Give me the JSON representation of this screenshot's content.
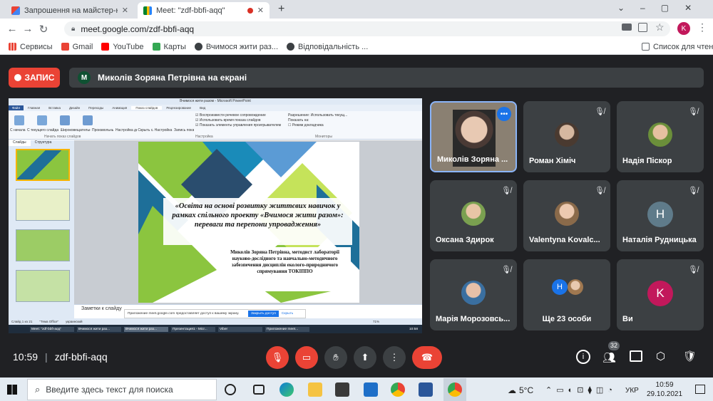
{
  "browser": {
    "tabs": [
      {
        "title": "Запрошення на майстер-клас «Осв",
        "favicon": "gmail-icon",
        "active": false
      },
      {
        "title": "Meet: \"zdf-bbfi-aqq\"",
        "favicon": "meet-icon",
        "active": true
      }
    ],
    "new_tab": "+",
    "url": "meet.google.com/zdf-bbfi-aqq",
    "profile_letter": "K",
    "bookmarks": [
      "Сервисы",
      "Gmail",
      "YouTube",
      "Карты",
      "Вчимося жити раз...",
      "Відповідальність ...",
      "Список для чтения"
    ]
  },
  "meet": {
    "record_label": "ЗАПИС",
    "presenter_avatar": "M",
    "presenter_banner": "Миколів Зоряна Петрівна на екрані",
    "tiles": [
      {
        "name": "Миколів Зоряна ...",
        "type": "video"
      },
      {
        "name": "Роман Хіміч",
        "type": "photo"
      },
      {
        "name": "Надія Піскор",
        "type": "photo"
      },
      {
        "name": "Оксана Здирок",
        "type": "photo"
      },
      {
        "name": "Valentyna Kovalc...",
        "type": "photo"
      },
      {
        "name": "Наталія Рудницька",
        "type": "letter",
        "letter": "Н",
        "color": "#5f7b8a"
      },
      {
        "name": "Марія Морозовсь...",
        "type": "photo"
      },
      {
        "name": "Ще 23 особи",
        "type": "group",
        "letter": "Н"
      },
      {
        "name": "Ви",
        "type": "letter",
        "letter": "K",
        "color": "#c2185b"
      }
    ],
    "time": "10:59",
    "meeting_code": "zdf-bbfi-aqq",
    "people_count": "32"
  },
  "ppt": {
    "title_bar": "Вчимося жити разом - Microsoft PowerPoint",
    "tabs": [
      "Файл",
      "Главная",
      "Вставка",
      "Дизайн",
      "Переходы",
      "Анимация",
      "Показ слайдов",
      "Рецензирование",
      "Вид"
    ],
    "ribbon_buttons": [
      "С начала",
      "С текущего слайда",
      "Широковещательный показ слайдов",
      "Произвольный показ",
      "Настройка демонстрации",
      "Скрыть слайд",
      "Настройка времени",
      "Запись показа слайдов"
    ],
    "ribbon_checks": [
      "Воспроизвести речевое сопровождение",
      "Использовать время показа слайдов",
      "Показать элементы управления проигрывателем"
    ],
    "ribbon_right": [
      "Разрешение:",
      "Использовать текущ...",
      "Показать на:",
      "Режим докладчика"
    ],
    "groups": [
      "Начать показ слайдов",
      "Настройка",
      "Мониторы"
    ],
    "pane_tabs": [
      "Слайды",
      "Структура"
    ],
    "slide_title": "«Освіта на основі розвитку життєвих навичок у рамках спільного проекту «Вчимося жити разом»: переваги та перепони упровадження»",
    "slide_author": "Миколів Зоряна Петрівна, методист лабораторії науково-дослідного та навчально-методичного забезпечення дисциплін еколого-природничого спрямування ТОКІППО",
    "notes": "Заметки к слайду",
    "share_notice": "Приложение meet.google.com предоставляет доступ к вашему экрану.",
    "stop_share": "Закрыть доступ",
    "hide": "Скрыть",
    "status": "Слайд 1 из 21",
    "theme": "\"Тема Office\"",
    "lang": "украинский",
    "zoom": "71%",
    "inner_taskbar": [
      "Meet: \"zdf-bbfi-aqq\"",
      "Вчимося жити раз...",
      "Вчимося жити раз...",
      "Презентация1 - Micr...",
      "Viber",
      "Приложение meet..."
    ],
    "inner_clock": "10:58"
  },
  "taskbar": {
    "search_placeholder": "Введите здесь текст для поиска",
    "weather": "5°C",
    "lang": "УКР",
    "time": "10:59",
    "date": "29.10.2021"
  }
}
